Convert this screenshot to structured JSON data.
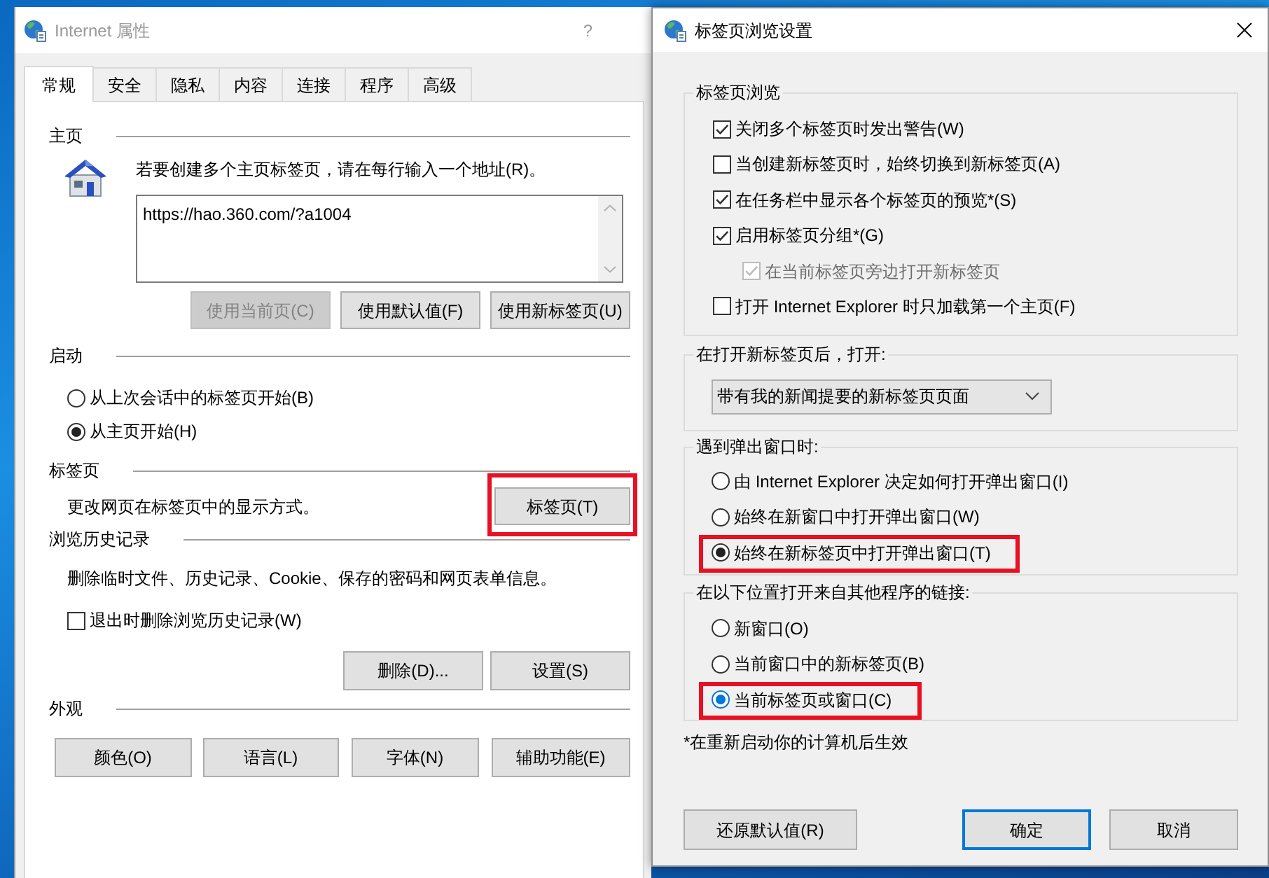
{
  "internet_options": {
    "title": "Internet 属性",
    "active": false,
    "help_button": "?",
    "tabs": [
      {
        "label": "常规",
        "selected": true
      },
      {
        "label": "安全",
        "selected": false
      },
      {
        "label": "隐私",
        "selected": false
      },
      {
        "label": "内容",
        "selected": false
      },
      {
        "label": "连接",
        "selected": false
      },
      {
        "label": "程序",
        "selected": false
      },
      {
        "label": "高级",
        "selected": false
      }
    ],
    "home_page": {
      "heading": "主页",
      "instruction": "若要创建多个主页标签页，请在每行输入一个地址(R)。",
      "addresses": "https://hao.360.com/?a1004",
      "buttons": [
        {
          "label": "使用当前页(C)",
          "disabled": true
        },
        {
          "label": "使用默认值(F)",
          "disabled": false
        },
        {
          "label": "使用新标签页(U)",
          "disabled": false
        }
      ]
    },
    "startup": {
      "heading": "启动",
      "options": [
        {
          "label": "从上次会话中的标签页开始(B)",
          "selected": false
        },
        {
          "label": "从主页开始(H)",
          "selected": true
        }
      ]
    },
    "tabs_section": {
      "heading": "标签页",
      "description": "更改网页在标签页中的显示方式。",
      "button": {
        "label": "标签页(T)",
        "highlighted": true
      }
    },
    "history": {
      "heading": "浏览历史记录",
      "description": "删除临时文件、历史记录、Cookie、保存的密码和网页表单信息。",
      "delete_on_exit": {
        "label": "退出时删除浏览历史记录(W)",
        "checked": false
      },
      "buttons": [
        "删除(D)...",
        "设置(S)"
      ]
    },
    "appearance": {
      "heading": "外观",
      "buttons": [
        "颜色(O)",
        "语言(L)",
        "字体(N)",
        "辅助功能(E)"
      ]
    }
  },
  "tab_settings": {
    "title": "标签页浏览设置",
    "active": true,
    "tabbed_browsing": {
      "heading": "标签页浏览",
      "options": [
        {
          "label": "关闭多个标签页时发出警告(W)",
          "checked": true,
          "disabled": false
        },
        {
          "label": "当创建新标签页时，始终切换到新标签页(A)",
          "checked": false,
          "disabled": false
        },
        {
          "label": "在任务栏中显示各个标签页的预览*(S)",
          "checked": true,
          "disabled": false
        },
        {
          "label": "启用标签页分组*(G)",
          "checked": true,
          "disabled": false,
          "children": [
            {
              "label": "在当前标签页旁边打开新标签页",
              "checked": true,
              "disabled": true
            }
          ]
        },
        {
          "label": "打开 Internet Explorer 时只加载第一个主页(F)",
          "checked": false,
          "disabled": false
        }
      ]
    },
    "new_tab_page": {
      "heading": "在打开新标签页后，打开:",
      "selection": "带有我的新闻提要的新标签页页面"
    },
    "popups": {
      "heading": "遇到弹出窗口时:",
      "options": [
        {
          "label": "由 Internet Explorer 决定如何打开弹出窗口(I)",
          "selected": false,
          "focused": false,
          "highlighted": false
        },
        {
          "label": "始终在新窗口中打开弹出窗口(W)",
          "selected": false,
          "focused": false,
          "highlighted": false
        },
        {
          "label": "始终在新标签页中打开弹出窗口(T)",
          "selected": true,
          "focused": false,
          "highlighted": true
        }
      ]
    },
    "external_links": {
      "heading": "在以下位置打开来自其他程序的链接:",
      "options": [
        {
          "label": "新窗口(O)",
          "selected": false,
          "focused": false,
          "highlighted": false
        },
        {
          "label": "当前窗口中的新标签页(B)",
          "selected": false,
          "focused": false,
          "highlighted": false
        },
        {
          "label": "当前标签页或窗口(C)",
          "selected": true,
          "focused": true,
          "highlighted": true
        }
      ]
    },
    "footnote": "*在重新启动你的计算机后生效",
    "buttons": [
      {
        "label": "还原默认值(R)",
        "default": false
      },
      {
        "label": "确定",
        "default": true
      },
      {
        "label": "取消",
        "default": false
      }
    ]
  }
}
